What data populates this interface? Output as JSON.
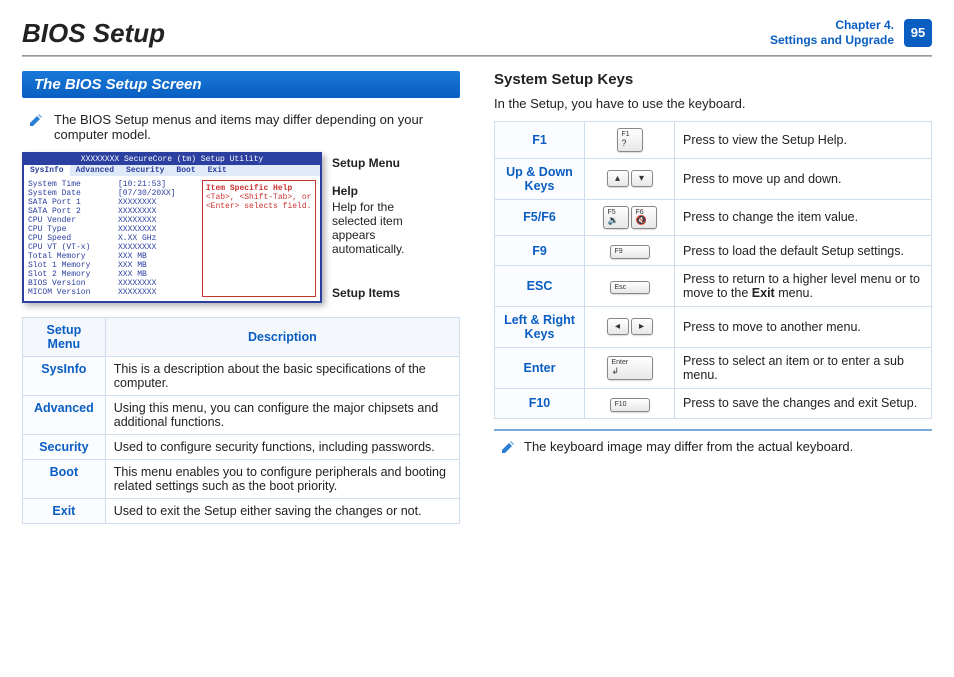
{
  "header": {
    "title": "BIOS Setup",
    "chapter_line1": "Chapter 4.",
    "chapter_line2": "Settings and Upgrade",
    "page_number": "95"
  },
  "left": {
    "section_title": "The BIOS Setup Screen",
    "note": "The BIOS Setup menus and items may differ depending on your computer model.",
    "bios": {
      "util_title": "XXXXXXXX SecureCore (tm) Setup Utility",
      "tabs": [
        "SysInfo",
        "Advanced",
        "Security",
        "Boot",
        "Exit"
      ],
      "rows": [
        {
          "k": "System Time",
          "v": "[10:21:53]"
        },
        {
          "k": "System Date",
          "v": "[07/30/20XX]"
        },
        {
          "k": "",
          "v": ""
        },
        {
          "k": "SATA Port 1",
          "v": "XXXXXXXX"
        },
        {
          "k": "SATA Port 2",
          "v": "XXXXXXXX"
        },
        {
          "k": "",
          "v": ""
        },
        {
          "k": "CPU Vender",
          "v": "XXXXXXXX"
        },
        {
          "k": "CPU Type",
          "v": "XXXXXXXX"
        },
        {
          "k": "CPU Speed",
          "v": "X.XX GHz"
        },
        {
          "k": "CPU VT (VT-x)",
          "v": "XXXXXXXX"
        },
        {
          "k": "",
          "v": ""
        },
        {
          "k": "Total Memory",
          "v": "XXX MB"
        },
        {
          "k": " Slot 1 Memory",
          "v": "XXX MB"
        },
        {
          "k": " Slot 2 Memory",
          "v": "XXX MB"
        },
        {
          "k": "",
          "v": ""
        },
        {
          "k": "BIOS Version",
          "v": "XXXXXXXX"
        },
        {
          "k": "MICOM Version",
          "v": "XXXXXXXX"
        }
      ],
      "help_title": "Item Specific Help",
      "help_body": "<Tab>, <Shift-Tab>, or <Enter> selects field."
    },
    "callouts": {
      "setup_menu": "Setup Menu",
      "help_label": "Help",
      "help_text": "Help for the selected item appears automatically.",
      "setup_items": "Setup Items"
    },
    "menu_table": {
      "headers": [
        "Setup Menu",
        "Description"
      ],
      "rows": [
        {
          "menu": "SysInfo",
          "desc": "This is a description about the basic specifications of the computer."
        },
        {
          "menu": "Advanced",
          "desc": "Using this menu, you can configure the major chipsets and additional functions."
        },
        {
          "menu": "Security",
          "desc": "Used to configure security functions, including passwords."
        },
        {
          "menu": "Boot",
          "desc": "This menu enables you to configure peripherals and booting related settings such as the boot priority."
        },
        {
          "menu": "Exit",
          "desc": "Used to exit the Setup either saving the changes or not."
        }
      ]
    }
  },
  "right": {
    "heading": "System Setup Keys",
    "intro": "In the Setup, you have to use the keyboard.",
    "keys": [
      {
        "name": "F1",
        "cap": "F1",
        "desc": "Press to view the Setup Help."
      },
      {
        "name": "Up & Down Keys",
        "cap": "updown",
        "desc": "Press to move up and down."
      },
      {
        "name": "F5/F6",
        "cap": "f5f6",
        "desc": "Press to change the item value."
      },
      {
        "name": "F9",
        "cap": "F9",
        "desc": "Press to load the default Setup settings."
      },
      {
        "name": "ESC",
        "cap": "Esc",
        "desc_html": "Press to return to a higher level menu or to move to the <b>Exit</b> menu."
      },
      {
        "name": "Left & Right Keys",
        "cap": "leftright",
        "desc": "Press to move to another menu."
      },
      {
        "name": "Enter",
        "cap": "Enter",
        "desc": "Press to select an item or to enter a sub menu."
      },
      {
        "name": "F10",
        "cap": "F10",
        "desc": "Press to save the changes and exit Setup."
      }
    ],
    "footer_note": "The keyboard image may differ from the actual keyboard."
  }
}
